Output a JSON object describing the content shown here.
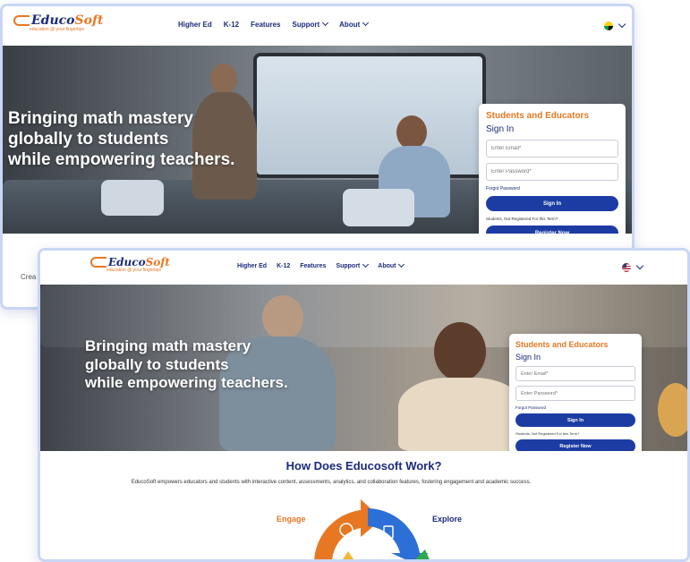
{
  "brand": {
    "logo_edu": "Educo",
    "logo_soft": "Soft",
    "tagline": "education @ your fingertips"
  },
  "nav": {
    "links": [
      "Higher Ed",
      "K-12",
      "Features",
      "Support",
      "About"
    ]
  },
  "hero": {
    "line1": "Bringing math mastery",
    "line2": "globally to students",
    "line3": "while empowering teachers."
  },
  "signin": {
    "heading": "Students and Educators",
    "title": "Sign In",
    "email_placeholder": "Enter Email*",
    "password_placeholder": "Enter Password*",
    "forgot": "Forgot Password",
    "signin_button": "Sign In",
    "not_registered": "Students, Not Registered For this Term?",
    "register_button": "Register Now"
  },
  "back_snippet": "Crea",
  "how": {
    "title": "How Does Educosoft Work?",
    "description": "EducoSoft empowers educators and students with interactive content, assessments, analytics, and collaboration features, fostering engagement and academic success.",
    "engage": "Engage",
    "explore": "Explore"
  },
  "colors": {
    "brand_blue": "#1b2a7a",
    "accent_orange": "#e87722",
    "button_blue": "#1d3ca3",
    "frame_border": "#c9d6f5"
  },
  "icons": {
    "flag_back": "jamaica-flag-icon",
    "flag_front": "us-flag-icon"
  }
}
